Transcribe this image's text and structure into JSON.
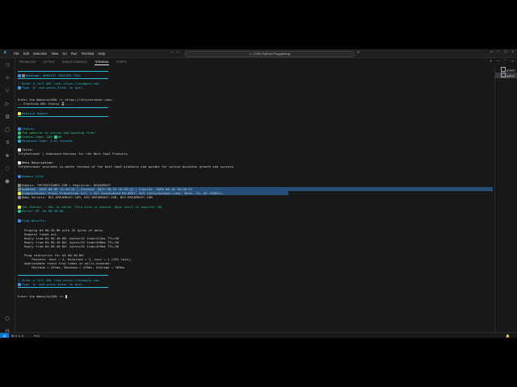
{
  "menu": [
    "File",
    "Edit",
    "Selection",
    "View",
    "Go",
    "Run",
    "Terminal",
    "Help"
  ],
  "command_center": "CS50 Python Programing",
  "panel": {
    "tabs": [
      "PROBLEMS",
      "OUTPUT",
      "DEBUG CONSOLE",
      "TERMINAL",
      "PORTS"
    ],
    "active_tab": "TERMINAL"
  },
  "side": {
    "items": [
      "power",
      "pytho"
    ]
  },
  "terminal": {
    "header": "WebSage: WEBSITE CHECKER TOOL",
    "prompt_hint_1": "Enter a full URL like https://example.com",
    "prompt_hint_2": "Type 'q' and press Enter to quit.",
    "input_prompt": "Enter the Website/URL >> https://thfyreviewer.com/",
    "checking": "-- Checking URL Status ⌛....",
    "report_title": "Website Report",
    "status_label": "Status:",
    "status_msg": "The website is online and working fine!",
    "status_code": "Status Code: 200",
    "status_ok": "OK",
    "response_time": "Response Time: 4.61 seconds",
    "title_label": "Title:",
    "title_value": "ThfyReviewer | Unbiased Reviews for the Best SaaS Products",
    "meta_label": "Meta Description:",
    "meta_value": "ThfyReviewer provides in-depth reviews of the best SaaS products and guides for online business growth and success.",
    "domain_label": "Domain Info:",
    "domain_line": "Domain: THFYREVIEWER.COM | Registrar: DREAMHOST",
    "updated_line": "Updated: 2025-08-06 12:43:25 | Created: 2022-08-10 16:26:22 | Expires: 2026-08-10 16:26:22",
    "org_line": "Organization: Proxy Protection LLC, | 417 Associated Rd #327, 9/3 (thfyreviewer.com), Brea, CA, US (92821)",
    "ns_line": "Name Servers: NS1.DREAMHOST.COM, NS2.DREAMHOST.COM, NS3.DREAMHOST.COM",
    "ssl_line": "SSL Status: ✓ SSL is valid. This site is secure. Days until it expires: 69",
    "server_ip": "Server IP: 64.90.49.86",
    "ping_label": "Ping Results:",
    "ping_lines": [
      "Pinging 64.90.49.86 with 32 bytes of data:",
      "Request timed out.",
      "Reply from 64.90.49.86: bytes=32 time=413ms TTL=36",
      "Reply from 64.90.49.86: bytes=32 time=258ms TTL=36",
      "Reply from 64.90.49.86: bytes=32 time=419ms TTL=36"
    ],
    "stats_lines": [
      "Ping statistics for 64.90.49.86:",
      "    Packets: Sent = 4, Received = 3, Lost = 1 (25% loss),",
      "Approximate round trip times in milli-seconds:",
      "    Minimum = 252ms, Maximum = 419ms, Average = 369ms"
    ],
    "final_prompt": "Enter the Website/URL >>"
  },
  "statusbar": {
    "errors": "0",
    "warnings": "0",
    "ports": "0"
  },
  "colors": {
    "accent": "#0078d4",
    "cyan": "#29b8db",
    "green": "#23d18b",
    "selection": "#264f78"
  }
}
